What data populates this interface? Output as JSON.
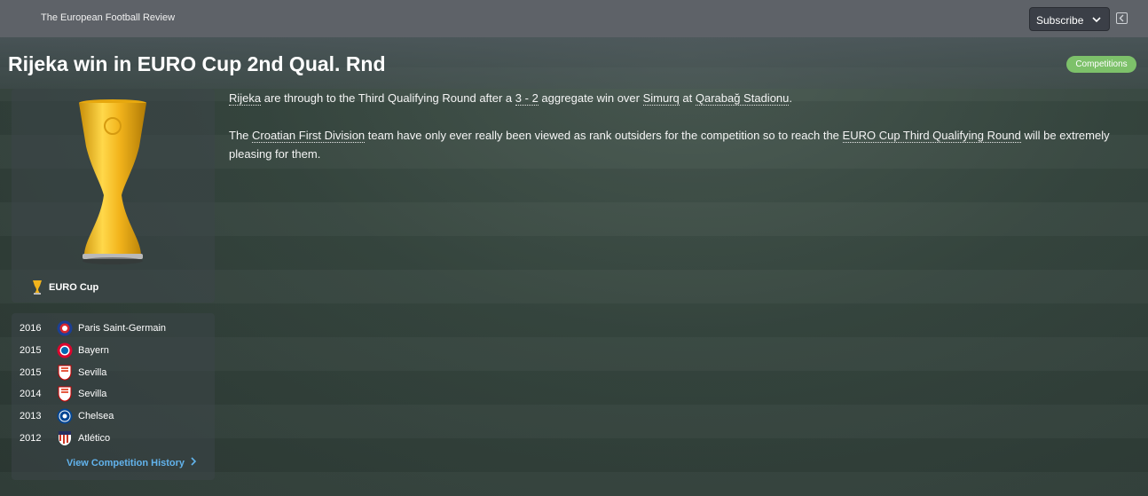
{
  "header": {
    "source": "The European Football Review",
    "subscribe_label": "Subscribe",
    "headline": "Rijeka win in EURO Cup 2nd Qual. Rnd",
    "badge": "Competitions"
  },
  "competition": {
    "name": "EURO Cup",
    "trophy_color": "#f2b41c"
  },
  "winners": [
    {
      "year": "2016",
      "club": "Paris Saint-Germain",
      "crest": "psg-crest-icon"
    },
    {
      "year": "2015",
      "club": "Bayern",
      "crest": "bayern-crest-icon"
    },
    {
      "year": "2015",
      "club": "Sevilla",
      "crest": "sevilla-crest-icon"
    },
    {
      "year": "2014",
      "club": "Sevilla",
      "crest": "sevilla-crest-icon"
    },
    {
      "year": "2013",
      "club": "Chelsea",
      "crest": "chelsea-crest-icon"
    },
    {
      "year": "2012",
      "club": "Atlético",
      "crest": "atletico-crest-icon"
    }
  ],
  "history_link": "View Competition History",
  "article": {
    "p1": {
      "team": "Rijeka",
      "t1": " are through to the Third Qualifying Round after a ",
      "score": "3 - 2",
      "t2": " aggregate win over ",
      "opponent": "Simurq",
      "t3": " at ",
      "stadium": "Qarabağ Stadionu",
      "t4": "."
    },
    "p2": {
      "t1": "The ",
      "league": "Croatian First Division",
      "t2": " team have only ever really been viewed as rank outsiders for the competition so to reach the ",
      "round": "EURO Cup Third Qualifying Round",
      "t3": " will be extremely pleasing for them."
    }
  },
  "colors": {
    "link": "#62b3ec",
    "badge": "#7dc16a",
    "topbar": "#5e6268"
  }
}
